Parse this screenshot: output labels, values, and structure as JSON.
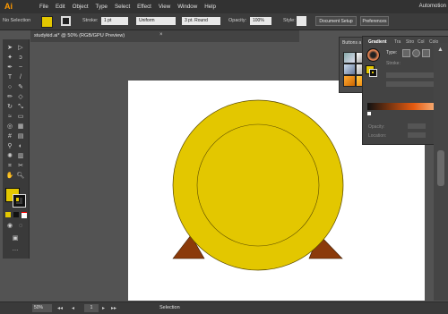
{
  "app": {
    "logo": "Ai",
    "workspace": "Automotion"
  },
  "menu": [
    "File",
    "Edit",
    "Object",
    "Type",
    "Select",
    "Effect",
    "View",
    "Window",
    "Help"
  ],
  "control_bar": {
    "selection_label": "No Selection",
    "stroke_label": "Stroke:",
    "stroke_value": "1 pt",
    "stroke_profile": "Uniform",
    "brush": "3 pt. Round",
    "opacity_label": "Opacity:",
    "opacity_value": "100%",
    "style_label": "Style:",
    "document_setup": "Document Setup",
    "preferences": "Preferences",
    "fill_color": "#e3c700"
  },
  "document_tab": {
    "title": "studykid.ai* @ 50% (RGB/GPU Preview)",
    "close": "×"
  },
  "panels": {
    "small_panel_title": "Buttons a",
    "gradient_tabs": [
      "Gradient",
      "Tra",
      "Stro",
      "Col",
      "Colo"
    ],
    "type_label": "Type:",
    "stroke_label": "Stroke:",
    "opacity_label": "Opacity:",
    "location_label": "Location:"
  },
  "status_bar": {
    "zoom": "50%",
    "page": "1",
    "tool": "Selection"
  },
  "colors": {
    "coin_fill": "#e3c700",
    "coin_stroke": "#5a4a00",
    "stand_fill": "#8b3a0a"
  }
}
